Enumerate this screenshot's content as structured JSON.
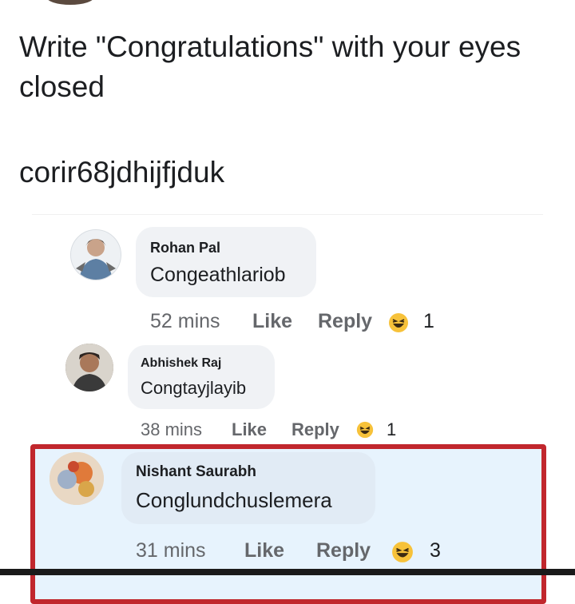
{
  "post": {
    "title": "Write \"Congratulations\" with your eyes closed",
    "body": "corir68jdhijfjduk"
  },
  "comments": [
    {
      "author": "Rohan Pal",
      "text": "Congeathlariob",
      "time": "52 mins",
      "like_label": "Like",
      "reply_label": "Reply",
      "reaction_icon": "haha-icon",
      "reaction_count": "1",
      "highlighted": false
    },
    {
      "author": "Abhishek Raj",
      "text": "Congtayjlayib",
      "time": "38 mins",
      "like_label": "Like",
      "reply_label": "Reply",
      "reaction_icon": "haha-icon",
      "reaction_count": "1",
      "highlighted": false
    },
    {
      "author": "Nishant Saurabh",
      "text": "Conglundchuslemera",
      "time": "31 mins",
      "like_label": "Like",
      "reply_label": "Reply",
      "reaction_icon": "haha-icon",
      "reaction_count": "3",
      "highlighted": true
    }
  ],
  "colors": {
    "highlight_border": "#c1272d",
    "highlight_background": "#e7f3fd",
    "bubble": "#f0f2f5",
    "meta_text": "#65676b",
    "reaction_yellow": "#f7c23a"
  }
}
